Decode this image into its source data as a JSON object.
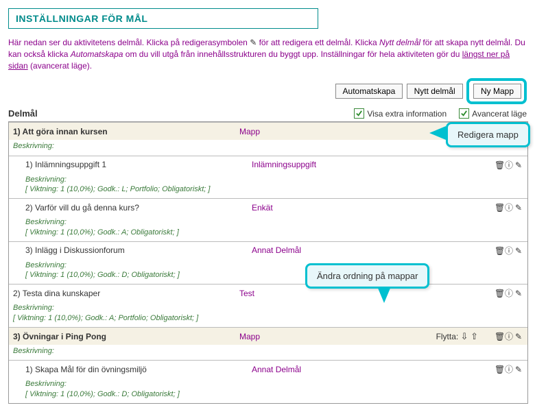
{
  "title": "INSTÄLLNINGAR FÖR MÅL",
  "intro": {
    "part1": "Här nedan ser du aktivitetens delmål. Klicka på redigerasymbolen ",
    "part2": " för att redigera ett delmål. Klicka ",
    "nytt_delmal": "Nytt delmål",
    "part3": " för att skapa nytt delmål. Du kan också klicka ",
    "automatskapa": "Automatskapa",
    "part4": " om du vill utgå från innehållsstrukturen du byggt upp. Inställningar för hela aktiviteten gör du ",
    "link": "längst ner på sidan",
    "part5": " (avancerat läge)."
  },
  "buttons": {
    "automatskapa": "Automatskapa",
    "nytt_delmal": "Nytt delmål",
    "ny_mapp": "Ny Mapp"
  },
  "section": {
    "heading": "Delmål",
    "visa_extra": "Visa extra information",
    "avancerat": "Avancerat läge"
  },
  "labels": {
    "beskrivning": "Beskrivning:",
    "flytta": "Flytta:"
  },
  "callouts": {
    "redigera_mapp": "Redigera mapp",
    "andra_ordning": "Ändra ordning på mappar"
  },
  "rows": [
    {
      "num": "1)",
      "title": "Att göra innan kursen",
      "type": "Mapp",
      "folder": true,
      "move_down": true,
      "move_up": false,
      "detail": ""
    },
    {
      "num": "1)",
      "title": "Inlämningsuppgift 1",
      "type": "Inlämningsuppgift",
      "folder": false,
      "sub": true,
      "detail": "[ Viktning: 1 (10,0%); Godk.: L; Portfolio; Obligatoriskt; ]"
    },
    {
      "num": "2)",
      "title": "Varför vill du gå denna kurs?",
      "type": "Enkät",
      "folder": false,
      "sub": true,
      "detail": "[ Viktning: 1 (10,0%); Godk.: A; Obligatoriskt; ]"
    },
    {
      "num": "3)",
      "title": "Inlägg i Diskussionforum",
      "type": "Annat Delmål",
      "folder": false,
      "sub": true,
      "detail": "[ Viktning: 1 (10,0%); Godk.: D; Obligatoriskt; ]"
    },
    {
      "num": "2)",
      "title": "Testa dina kunskaper",
      "type": "Test",
      "folder": false,
      "sub": false,
      "detail": "[ Viktning: 1 (10,0%); Godk.: A; Portfolio; Obligatoriskt; ]"
    },
    {
      "num": "3)",
      "title": "Övningar i Ping Pong",
      "type": "Mapp",
      "folder": true,
      "move_down": true,
      "move_up": true,
      "detail": ""
    },
    {
      "num": "1)",
      "title": "Skapa Mål för din övningsmiljö",
      "type": "Annat Delmål",
      "folder": false,
      "sub": true,
      "detail": "[ Viktning: 1 (10,0%); Godk.: D; Obligatoriskt; ]"
    }
  ]
}
